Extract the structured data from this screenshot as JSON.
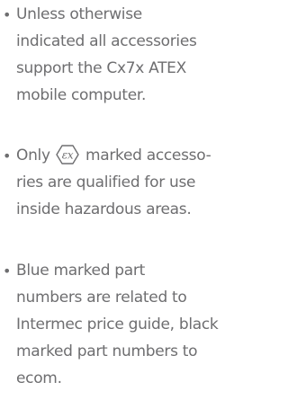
{
  "notes": [
    {
      "bullet": "•",
      "lines": [
        "Unless otherwise",
        "indicated all accessories",
        "support the Cx7x ATEX",
        "mobile computer."
      ]
    },
    {
      "bullet": "•",
      "first_line_before_icon": "Only",
      "icon_label": "εx",
      "first_line_after_icon": "marked accesso-",
      "lines": [
        "ries are qualified for use",
        "inside hazardous areas."
      ]
    },
    {
      "bullet": "•",
      "lines": [
        "Blue marked part",
        "numbers are related to",
        "Intermec price guide, black",
        "marked part numbers to",
        "ecom."
      ]
    }
  ],
  "icon": {
    "name": "atex-ex-marking-icon"
  },
  "colors": {
    "text": "#6e6e70",
    "background": "#ffffff"
  }
}
